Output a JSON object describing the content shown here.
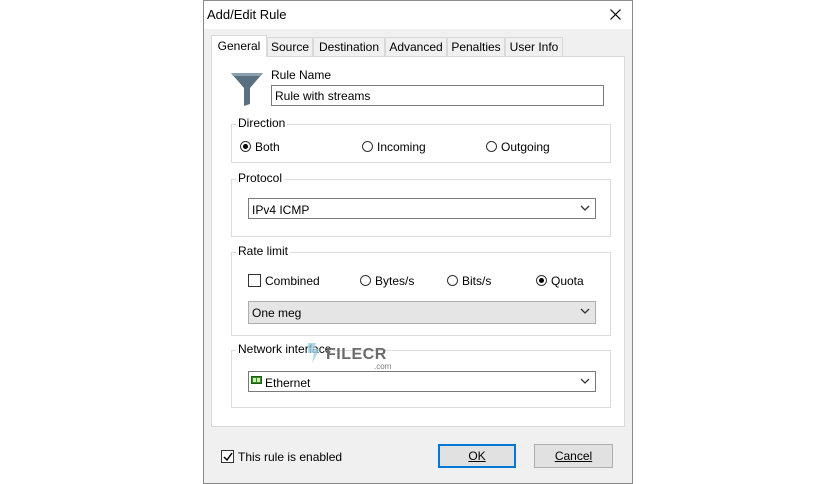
{
  "window": {
    "title": "Add/Edit Rule"
  },
  "tabs": [
    {
      "label": "General"
    },
    {
      "label": "Source"
    },
    {
      "label": "Destination"
    },
    {
      "label": "Advanced"
    },
    {
      "label": "Penalties"
    },
    {
      "label": "User Info"
    }
  ],
  "rule_name": {
    "label": "Rule Name",
    "value": "Rule with streams"
  },
  "direction": {
    "label": "Direction",
    "options": [
      "Both",
      "Incoming",
      "Outgoing"
    ],
    "selected": "Both"
  },
  "protocol": {
    "label": "Protocol",
    "value": "IPv4 ICMP"
  },
  "rate_limit": {
    "label": "Rate limit",
    "combined_label": "Combined",
    "combined_checked": false,
    "options": [
      "Bytes/s",
      "Bits/s",
      "Quota"
    ],
    "selected": "Quota",
    "quota_value": "One meg"
  },
  "network_interface": {
    "label": "Network interface",
    "value": "Ethernet"
  },
  "watermark": {
    "text": "FILECR",
    "sub": ".com"
  },
  "footer": {
    "enabled_label": "This rule is enabled",
    "enabled_checked": true,
    "ok_label": "OK",
    "cancel_label": "Cancel"
  },
  "icons": {
    "rule": "filter-funnel-icon",
    "close": "close-icon",
    "dropdown": "chevron-down-icon",
    "interface": "network-adapter-icon",
    "check": "checkmark-icon"
  },
  "colors": {
    "default_button_border": "#0078d7",
    "funnel": "#5a7080"
  }
}
